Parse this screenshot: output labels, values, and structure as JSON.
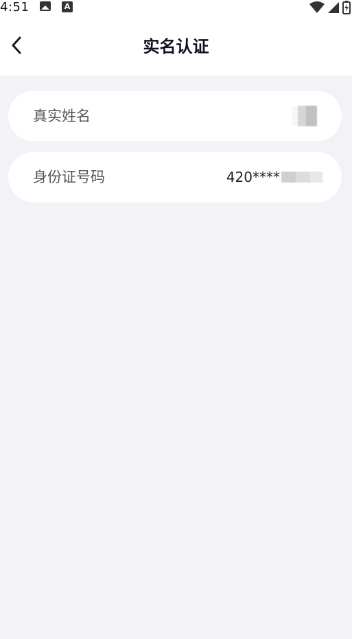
{
  "status_bar": {
    "time": "4:51",
    "icons": [
      "image-icon",
      "a-box-icon",
      "wifi-icon",
      "signal-icon",
      "battery-charging-icon"
    ]
  },
  "header": {
    "title": "实名认证",
    "back_icon": "chevron-left-icon"
  },
  "fields": [
    {
      "label": "真实姓名",
      "value": "",
      "value_masked": true
    },
    {
      "label": "身份证号码",
      "value": "420****",
      "value_masked": true
    }
  ],
  "colors": {
    "background": "#f2f2f7",
    "card": "#ffffff",
    "label": "#55565a",
    "title": "#111122"
  }
}
